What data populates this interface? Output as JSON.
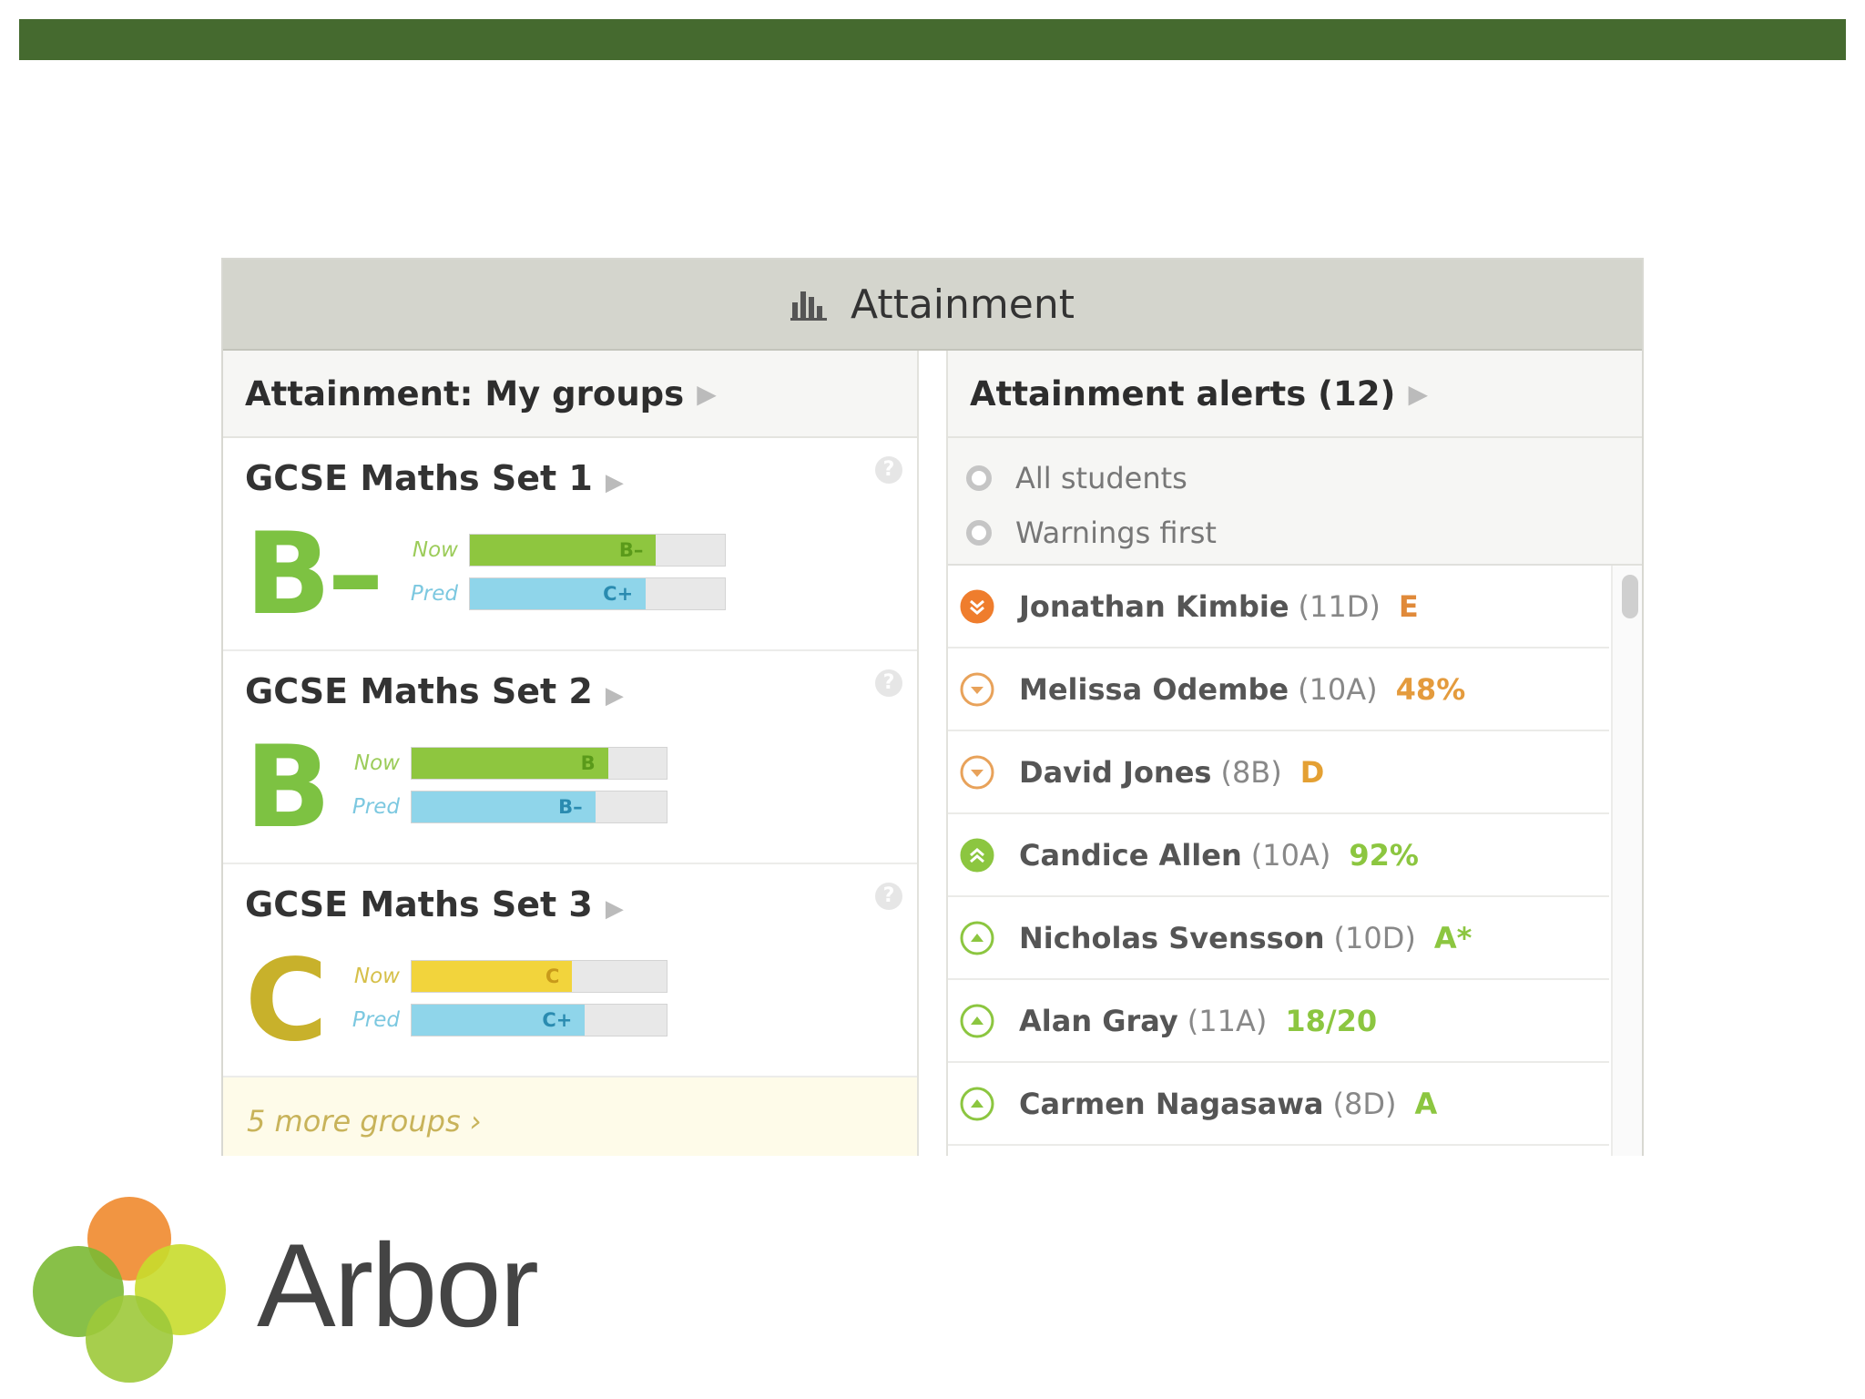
{
  "widget": {
    "title": "Attainment",
    "left_section_title": "Attainment: My groups",
    "right_section_title": "Attainment alerts (12)"
  },
  "groups": [
    {
      "title": "GCSE Maths Set 1",
      "grade": "B–",
      "grade_color": "#7dc242",
      "now_label": "Now",
      "now_grade": "B–",
      "now_fraction": 0.73,
      "now_color": "#8ec63f",
      "pred_label": "Pred",
      "pred_grade": "C+",
      "pred_fraction": 0.69,
      "pred_color": "#8fd5ea"
    },
    {
      "title": "GCSE Maths Set 2",
      "grade": "B",
      "grade_color": "#7dc242",
      "now_label": "Now",
      "now_grade": "B",
      "now_fraction": 0.77,
      "now_color": "#8ec63f",
      "pred_label": "Pred",
      "pred_grade": "B–",
      "pred_fraction": 0.72,
      "pred_color": "#8fd5ea"
    },
    {
      "title": "GCSE Maths Set 3",
      "grade": "C",
      "grade_color": "#c8b12b",
      "now_label": "Now",
      "now_grade": "C",
      "now_fraction": 0.63,
      "now_color": "#f2d43c",
      "pred_label": "Pred",
      "pred_grade": "C+",
      "pred_fraction": 0.68,
      "pred_color": "#8fd5ea"
    }
  ],
  "more_groups": "5 more groups",
  "filters": [
    "All students",
    "Warnings first"
  ],
  "alerts": [
    {
      "name": "Jonathan Kimbie",
      "class": "(11D)",
      "value": "E",
      "value_color": "#e08a3a",
      "icon": "double-down-icon",
      "icon_color": "#ef7d2d",
      "filled": true
    },
    {
      "name": "Melissa Odembe",
      "class": "(10A)",
      "value": "48%",
      "value_color": "#e49b3d",
      "icon": "down-icon",
      "icon_color": "#e8a25a",
      "filled": false
    },
    {
      "name": "David Jones",
      "class": "(8B)",
      "value": "D",
      "value_color": "#e4a033",
      "icon": "down-icon",
      "icon_color": "#e8a25a",
      "filled": false
    },
    {
      "name": "Candice Allen",
      "class": "(10A)",
      "value": "92%",
      "value_color": "#8cc640",
      "icon": "double-up-icon",
      "icon_color": "#8cc640",
      "filled": true
    },
    {
      "name": "Nicholas Svensson",
      "class": "(10D)",
      "value": "A*",
      "value_color": "#8cc640",
      "icon": "up-icon",
      "icon_color": "#8cc640",
      "filled": false
    },
    {
      "name": "Alan Gray",
      "class": "(11A)",
      "value": "18/20",
      "value_color": "#8cc640",
      "icon": "up-icon",
      "icon_color": "#8cc640",
      "filled": false
    },
    {
      "name": "Carmen Nagasawa",
      "class": "(8D)",
      "value": "A",
      "value_color": "#8cc640",
      "icon": "up-icon",
      "icon_color": "#8cc640",
      "filled": false
    }
  ],
  "brand": {
    "name": "Arbor",
    "colors": [
      "#ef8a2e",
      "#7bb934",
      "#c8dc2c",
      "#9dc93a"
    ],
    "bar_color": "#456a2f"
  }
}
